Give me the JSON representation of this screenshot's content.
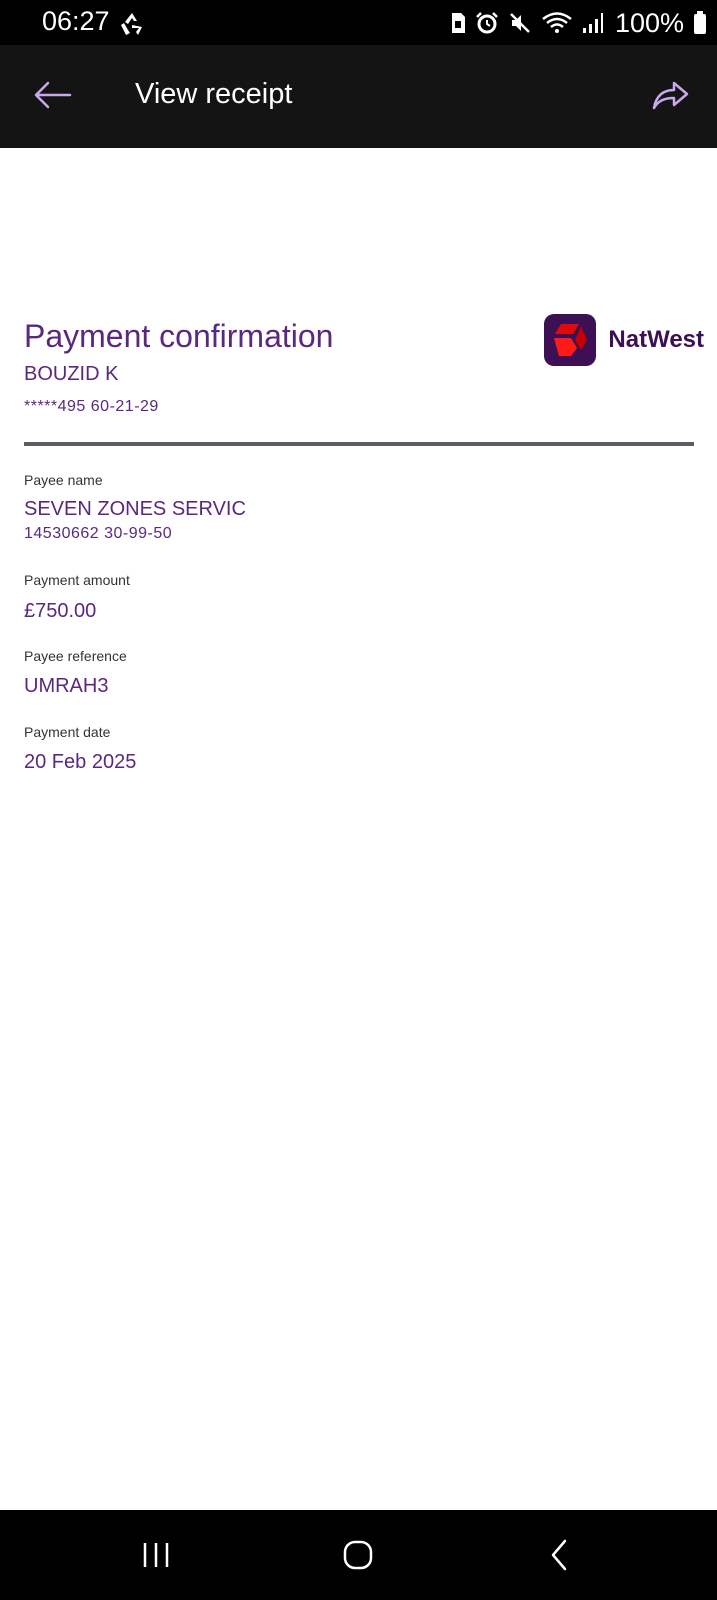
{
  "status_bar": {
    "time": "06:27",
    "battery": "100%",
    "icons": [
      "recycle-icon",
      "sim-icon",
      "alarm-icon",
      "mute-icon",
      "wifi-icon",
      "signal-icon",
      "battery-icon"
    ]
  },
  "app_bar": {
    "title": "View receipt",
    "back_icon": "arrow-left-icon",
    "share_icon": "share-icon"
  },
  "receipt": {
    "heading": "Payment confirmation",
    "account_name": "BOUZID K",
    "account_number": "*****495 60-21-29",
    "brand_name": "NatWest",
    "fields": {
      "payee_name_label": "Payee name",
      "payee_name": "SEVEN ZONES SERVIC",
      "payee_account": "14530662 30-99-50",
      "amount_label": "Payment amount",
      "amount": "£750.00",
      "reference_label": "Payee reference",
      "reference": "UMRAH3",
      "date_label": "Payment date",
      "date": "20 Feb 2025"
    }
  },
  "colors": {
    "brand_purple": "#5a287d",
    "logo_bg": "#3c1053",
    "logo_red": "#e10a0a",
    "accent_lilac": "#c9a8ee",
    "app_bar_bg": "#141414"
  },
  "nav_bar": {
    "icons": [
      "recents-icon",
      "home-icon",
      "back-icon"
    ]
  }
}
